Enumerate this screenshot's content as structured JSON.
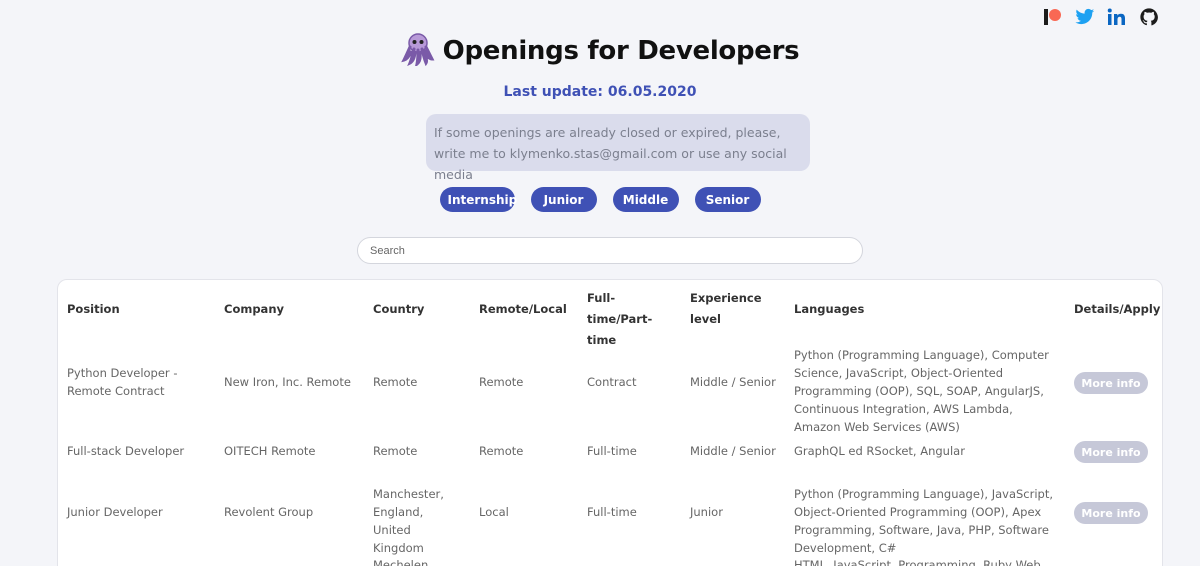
{
  "social": [
    "patreon-icon",
    "twitter-icon",
    "linkedin-icon",
    "github-icon"
  ],
  "header": {
    "title": "Openings for Developers"
  },
  "update": "Last update: 06.05.2020",
  "notice": "If some openings are already closed or expired, please, write me to klymenko.stas@gmail.com or use any social media",
  "levels": [
    "Internship",
    "Junior",
    "Middle",
    "Senior"
  ],
  "search": {
    "placeholder": "Search"
  },
  "table": {
    "headers": [
      "Position",
      "Company",
      "Country",
      "Remote/Local",
      "Full-time/Part-time",
      "Experience level",
      "Languages",
      "Details/Apply"
    ],
    "rows": [
      {
        "position": "Python Developer - Remote Contract",
        "company": "New Iron, Inc. Remote",
        "country": "Remote",
        "remote": "Remote",
        "type": "Contract",
        "level": "Middle / Senior",
        "languages": "Python (Programming Language), Computer Science, JavaScript, Object-Oriented Programming (OOP), SQL, SOAP, AngularJS, Continuous Integration, AWS Lambda, Amazon Web Services (AWS)",
        "action": "More info"
      },
      {
        "position": "Full-stack Developer",
        "company": "OITECH Remote",
        "country": "Remote",
        "remote": "Remote",
        "type": "Full-time",
        "level": "Middle / Senior",
        "languages": "GraphQL ed RSocket, Angular",
        "action": "More info"
      },
      {
        "position": "Junior Developer",
        "company": "Revolent Group",
        "country": "Manchester, England, United Kingdom",
        "remote": "Local",
        "type": "Full-time",
        "level": "Junior",
        "languages": "Python (Programming Language), JavaScript, Object-Oriented Programming (OOP), Apex Programming, Software, Java, PHP, Software Development, C#",
        "action": "More info"
      },
      {
        "country": "Mechelen,",
        "languages": "HTML, JavaScript, Programming, Ruby Web"
      }
    ]
  },
  "colors": {
    "accent": "#3f51b5",
    "background": "#f4f5f9",
    "notice": "#dadcec"
  }
}
